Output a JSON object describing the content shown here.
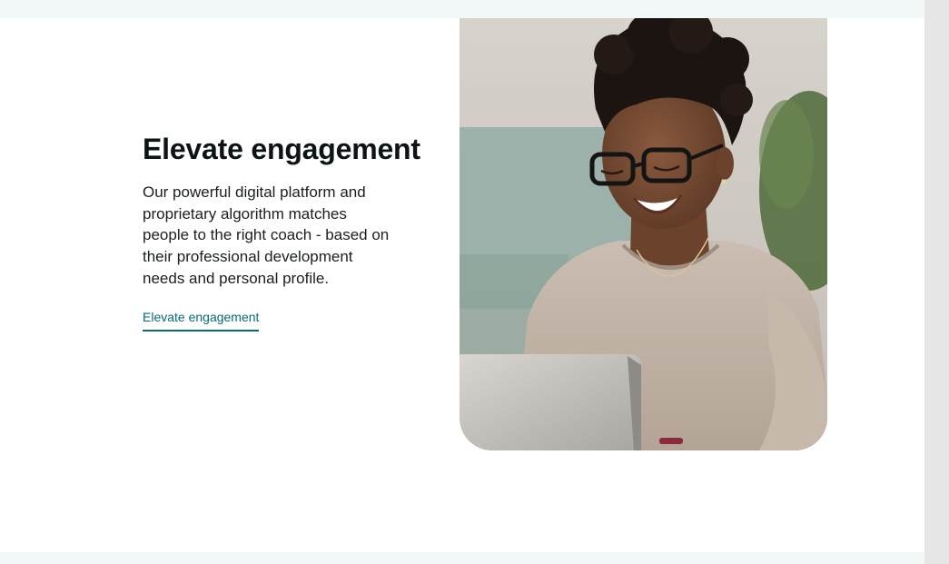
{
  "feature": {
    "heading": "Elevate engagement",
    "body": "Our powerful digital platform and proprietary algorithm matches people to the right coach - based on their professional development needs and personal profile.",
    "link_label": "Elevate engagement"
  },
  "image": {
    "subject": "smiling-woman-with-glasses-using-laptop-photo"
  },
  "colors": {
    "band_background": "#f2f8f8",
    "heading": "#0d1416",
    "link_accent": "#0a6a76",
    "scrollbar_track": "#e6e6e6"
  }
}
